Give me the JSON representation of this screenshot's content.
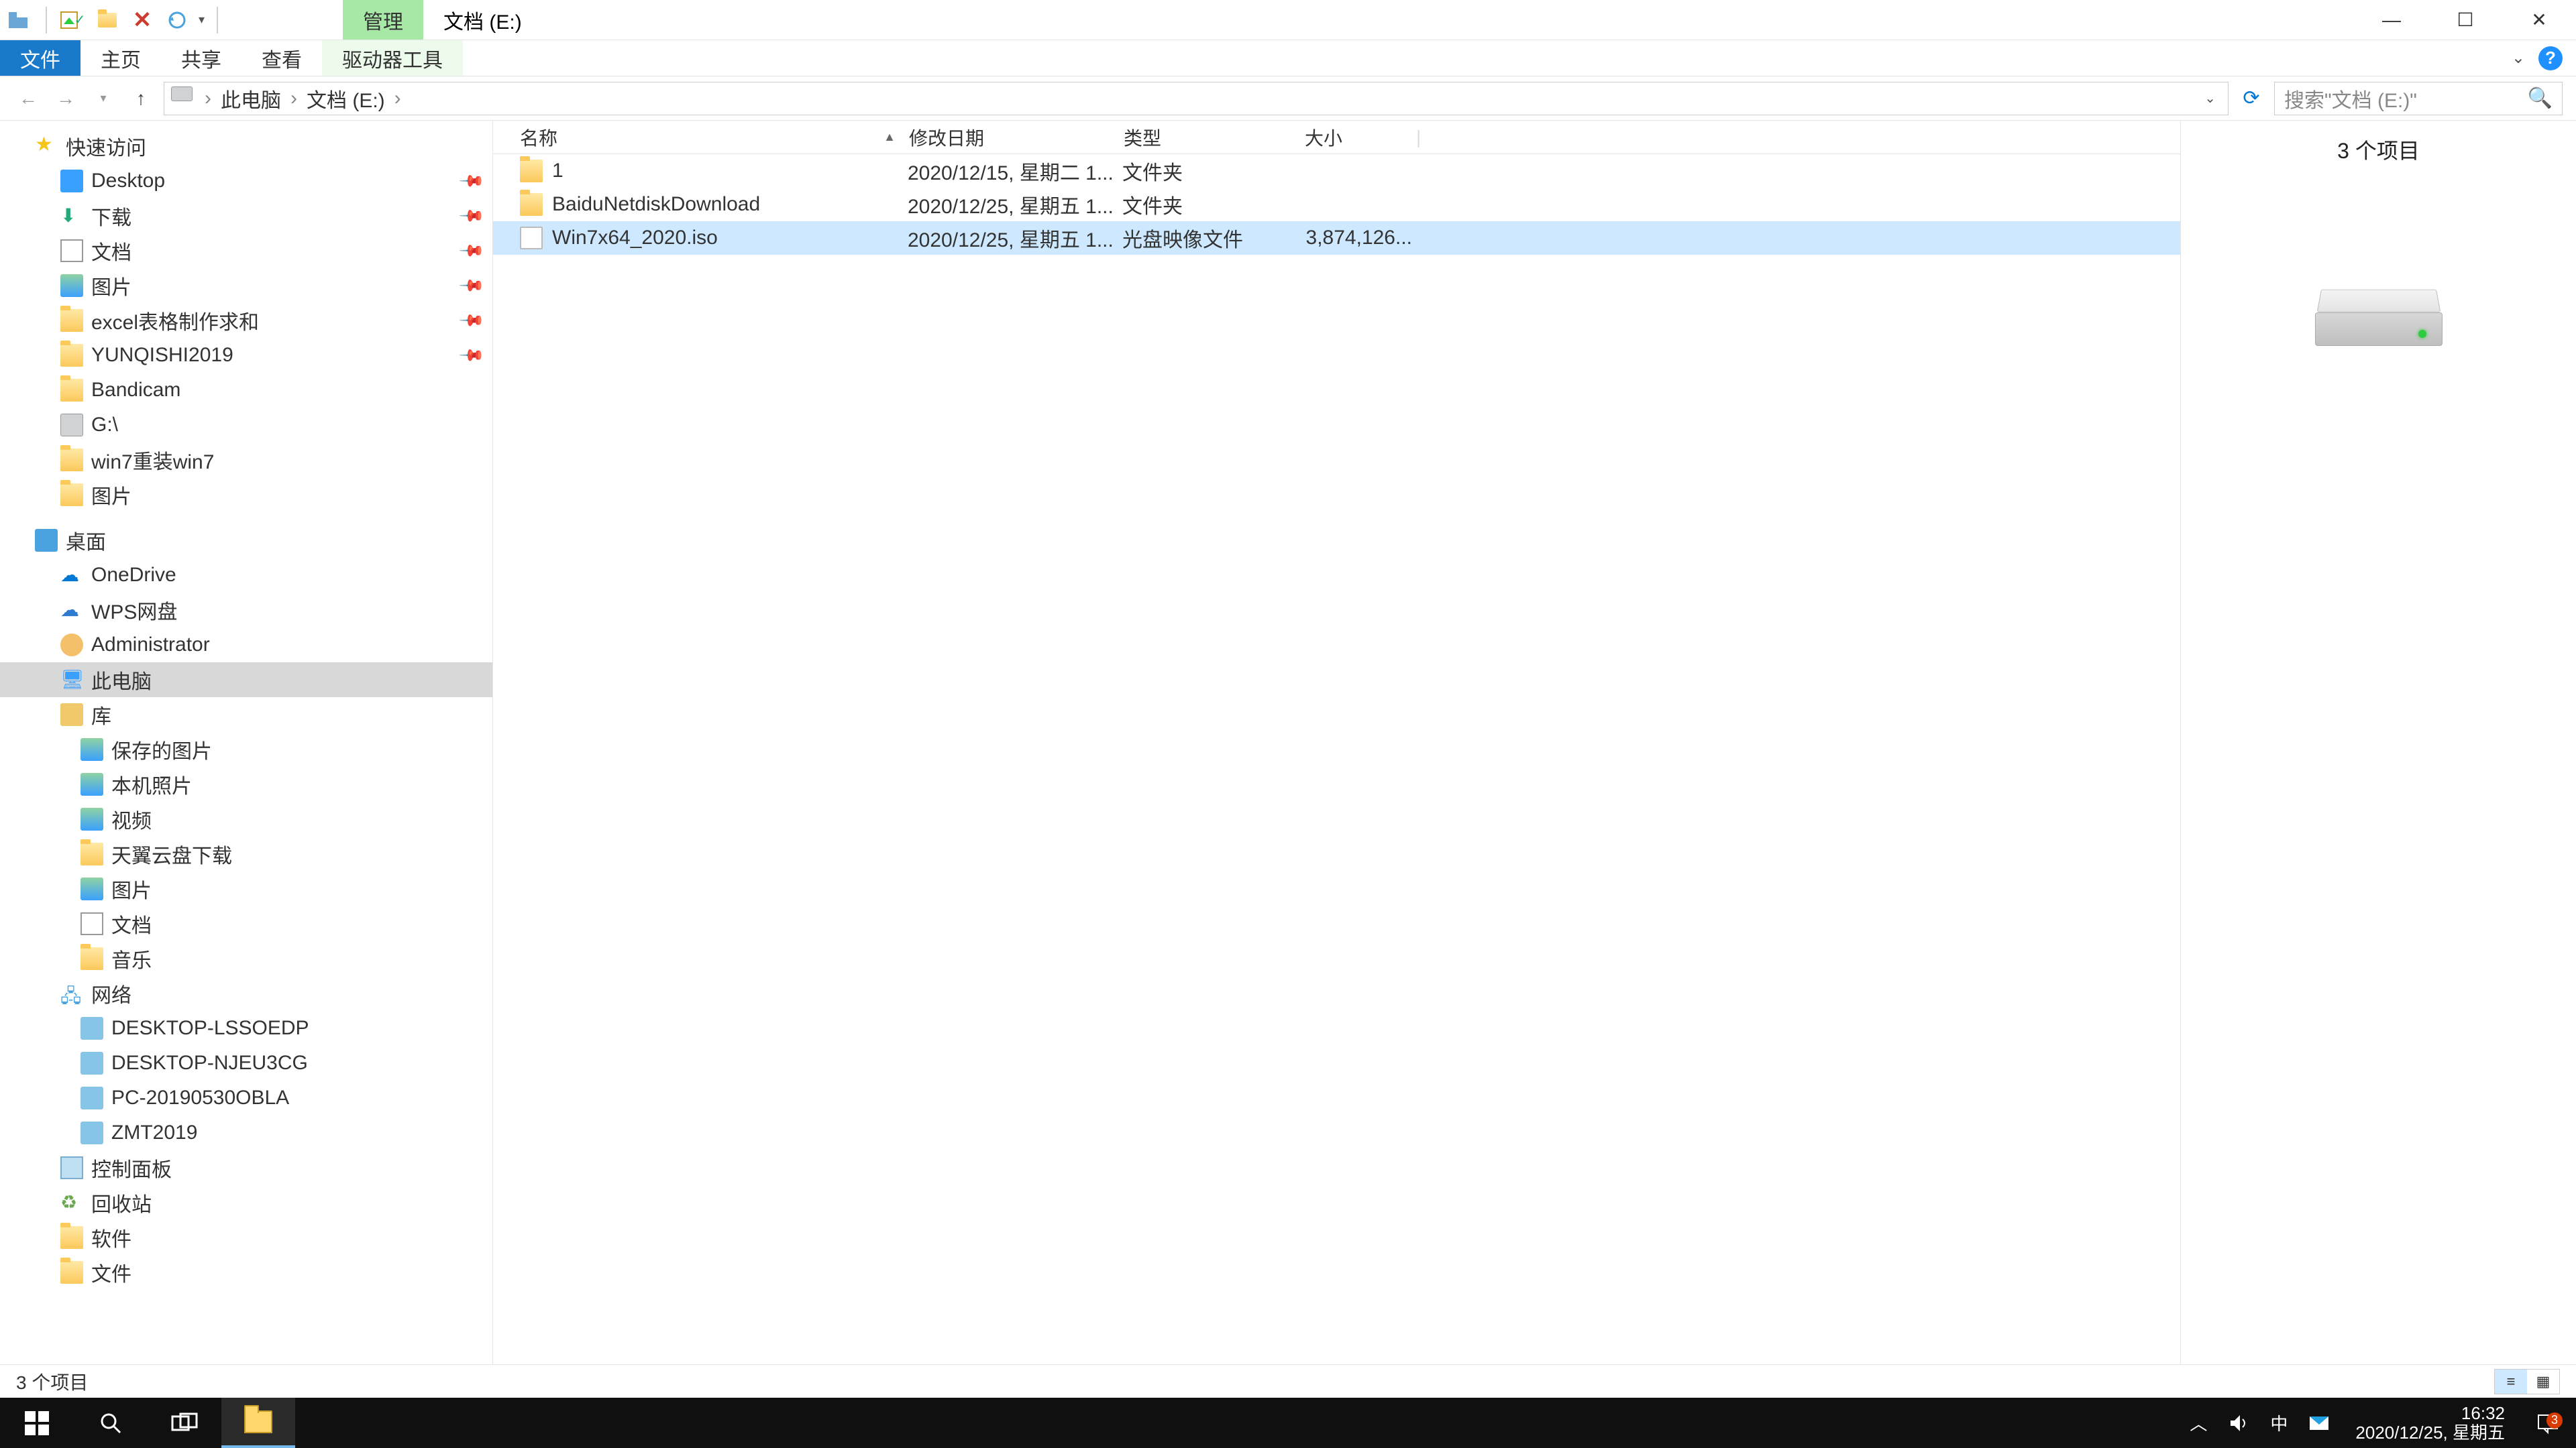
{
  "title_bar": {
    "contextual_tab": "管理",
    "window_title": "文档 (E:)"
  },
  "ribbon": {
    "tabs": {
      "file": "文件",
      "home": "主页",
      "share": "共享",
      "view": "查看",
      "drive_tools": "驱动器工具"
    }
  },
  "breadcrumb": {
    "root_icon": "pc",
    "items": [
      "此电脑",
      "文档 (E:)"
    ]
  },
  "search": {
    "placeholder": "搜索\"文档 (E:)\""
  },
  "sidebar": {
    "quick_access": {
      "label": "快速访问"
    },
    "qa_items": [
      {
        "label": "Desktop",
        "pinned": true,
        "icon": "desktop"
      },
      {
        "label": "下载",
        "pinned": true,
        "icon": "download"
      },
      {
        "label": "文档",
        "pinned": true,
        "icon": "doc"
      },
      {
        "label": "图片",
        "pinned": true,
        "icon": "pic"
      },
      {
        "label": "excel表格制作求和",
        "pinned": true,
        "icon": "folder"
      },
      {
        "label": "YUNQISHI2019",
        "pinned": true,
        "icon": "folder"
      },
      {
        "label": "Bandicam",
        "pinned": false,
        "icon": "folder"
      },
      {
        "label": "G:\\",
        "pinned": false,
        "icon": "drive"
      },
      {
        "label": "win7重装win7",
        "pinned": false,
        "icon": "folder"
      },
      {
        "label": "图片",
        "pinned": false,
        "icon": "folder"
      }
    ],
    "desktop_group": {
      "label": "桌面"
    },
    "desktop_items": [
      {
        "label": "OneDrive",
        "icon": "onedrive"
      },
      {
        "label": "WPS网盘",
        "icon": "wps"
      },
      {
        "label": "Administrator",
        "icon": "user"
      },
      {
        "label": "此电脑",
        "icon": "pc",
        "selected": true
      },
      {
        "label": "库",
        "icon": "lib"
      }
    ],
    "lib_items": [
      {
        "label": "保存的图片",
        "icon": "pic"
      },
      {
        "label": "本机照片",
        "icon": "pic"
      },
      {
        "label": "视频",
        "icon": "pic"
      },
      {
        "label": "天翼云盘下载",
        "icon": "folder"
      },
      {
        "label": "图片",
        "icon": "pic"
      },
      {
        "label": "文档",
        "icon": "doc"
      },
      {
        "label": "音乐",
        "icon": "folder"
      }
    ],
    "network": {
      "label": "网络"
    },
    "net_items": [
      {
        "label": "DESKTOP-LSSOEDP"
      },
      {
        "label": "DESKTOP-NJEU3CG"
      },
      {
        "label": "PC-20190530OBLA"
      },
      {
        "label": "ZMT2019"
      }
    ],
    "misc_items": [
      {
        "label": "控制面板",
        "icon": "panel"
      },
      {
        "label": "回收站",
        "icon": "recycle"
      },
      {
        "label": "软件",
        "icon": "folder"
      },
      {
        "label": "文件",
        "icon": "folder"
      }
    ]
  },
  "columns": {
    "name": "名称",
    "date": "修改日期",
    "type": "类型",
    "size": "大小"
  },
  "files": [
    {
      "name": "1",
      "date": "2020/12/15, 星期二 1...",
      "type": "文件夹",
      "size": "",
      "icon": "folder",
      "selected": false
    },
    {
      "name": "BaiduNetdiskDownload",
      "date": "2020/12/25, 星期五 1...",
      "type": "文件夹",
      "size": "",
      "icon": "folder",
      "selected": false
    },
    {
      "name": "Win7x64_2020.iso",
      "date": "2020/12/25, 星期五 1...",
      "type": "光盘映像文件",
      "size": "3,874,126...",
      "icon": "file",
      "selected": true
    }
  ],
  "preview": {
    "summary": "3 个项目"
  },
  "status": {
    "text": "3 个项目"
  },
  "taskbar": {
    "time": "16:32",
    "date": "2020/12/25, 星期五",
    "ime": "中",
    "notifications": "3"
  }
}
